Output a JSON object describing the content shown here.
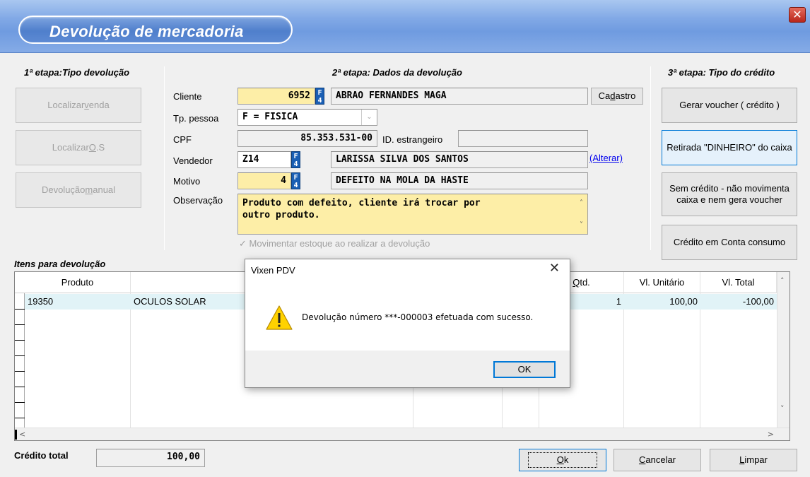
{
  "window": {
    "title": "Devolução de mercadoria",
    "close_glyph": "✕"
  },
  "step1": {
    "title": "1ª etapa:Tipo devolução",
    "buttons": [
      {
        "pre": "Localizar ",
        "ul": "v",
        "post": "enda"
      },
      {
        "pre": "Localizar ",
        "ul": "O",
        "post": ".S"
      },
      {
        "pre": "Devolução ",
        "ul": "m",
        "post": "anual"
      }
    ]
  },
  "step2": {
    "title": "2ª etapa: Dados da devolução",
    "cliente_label": "Cliente",
    "cliente_code": "6952",
    "cliente_name": "ABRAO FERNANDES MAGA",
    "cadastro_pre": "Ca",
    "cadastro_ul": "d",
    "cadastro_post": "astro",
    "tp_pessoa_label": "Tp. pessoa",
    "tp_pessoa_value": "F = FISICA",
    "cpf_label": "CPF",
    "cpf_value": "85.353.531-00",
    "id_estrangeiro_label": "ID. estrangeiro",
    "id_estrangeiro_value": "",
    "vendedor_label": "Vendedor",
    "vendedor_code": "Z14",
    "vendedor_name": "LARISSA SILVA DOS SANTOS",
    "alterar_link": "(Alterar)",
    "motivo_label": "Motivo",
    "motivo_code": "4",
    "motivo_name": "DEFEITO NA MOLA DA HASTE",
    "observacao_label": "Observação",
    "observacao_line1": "Produto com defeito, cliente irá trocar por",
    "observacao_line2": "outro produto.",
    "movimentar_label": "Movimentar estoque ao realizar a devolução",
    "f4_glyph": "F 4"
  },
  "step3": {
    "title": "3ª etapa: Tipo do crédito",
    "btn_voucher": "Gerar voucher ( crédito )",
    "btn_retirada": "Retirada \"DINHEIRO\" do caixa",
    "btn_sem_credito": "Sem crédito - não movimenta caixa e nem gera voucher",
    "btn_credito_conta": "Crédito em Conta consumo"
  },
  "items": {
    "title": "Itens para devolução",
    "headers": {
      "produto": "Produto",
      "qtd_ul": "Q",
      "qtd_rest": "td.",
      "vl_unitario": "Vl. Unitário",
      "vl_total": "Vl. Total"
    },
    "rows": [
      {
        "codigo": "19350",
        "descricao": "OCULOS SOLAR",
        "qtd": "1",
        "vl_unitario": "100,00",
        "vl_total": "-100,00"
      }
    ]
  },
  "footer": {
    "credito_total_label": "Crédito total",
    "credito_total_value": "100,00",
    "ok_ul": "O",
    "ok_rest": "k",
    "cancelar_ul": "C",
    "cancelar_rest": "ancelar",
    "limpar_ul": "L",
    "limpar_rest": "impar"
  },
  "dialog": {
    "title": "Vixen PDV",
    "message": "Devolução número ***-000003 efetuada com sucesso.",
    "ok_label": "OK",
    "close_glyph": "✕"
  },
  "colors": {
    "accent": "#0078d7",
    "title_blue": "#4f7fcc",
    "highlight_yellow": "#fdeea7",
    "f4_blue": "#1a5fb4"
  }
}
